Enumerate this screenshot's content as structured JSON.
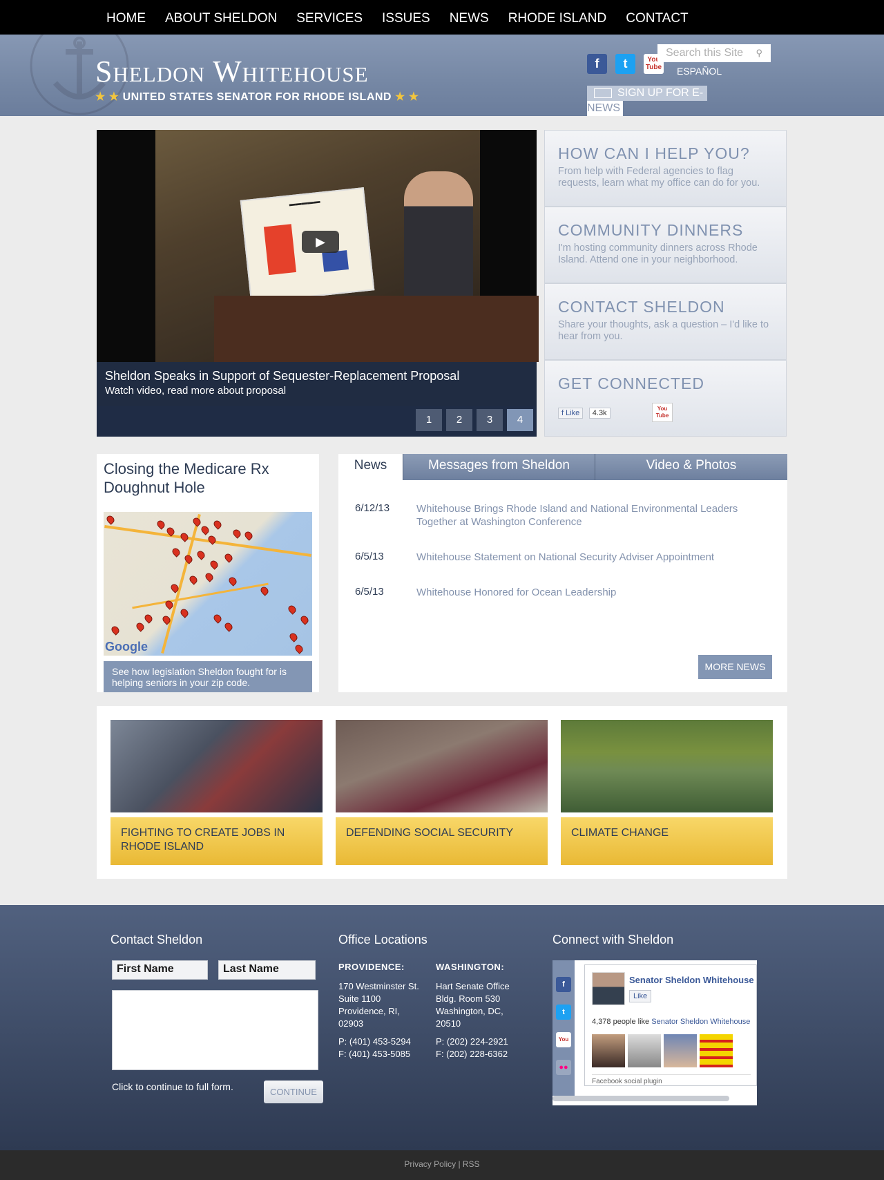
{
  "nav": [
    "HOME",
    "ABOUT SHELDON",
    "SERVICES",
    "ISSUES",
    "NEWS",
    "RHODE ISLAND",
    "CONTACT"
  ],
  "header": {
    "title": "Sheldon Whitehouse",
    "subtitle": "UNITED STATES SENATOR FOR RHODE ISLAND",
    "search_placeholder": "Search this Site",
    "espanol": "ESPAÑOL",
    "signup_line1": "SIGN UP FOR E-",
    "signup_line2": "NEWS",
    "icons": [
      "facebook-icon",
      "twitter-icon",
      "youtube-icon",
      "search-icon",
      "envelope-icon"
    ]
  },
  "hero": {
    "title": "Sheldon Speaks in Support of Sequester-Replacement Proposal",
    "subtitle": "Watch video, read more about proposal",
    "pages": [
      "1",
      "2",
      "3",
      "4"
    ],
    "active_page": "4"
  },
  "sidebar": [
    {
      "title": "HOW CAN I HELP YOU?",
      "text": "From help with Federal agencies to flag requests, learn what my office can do for you."
    },
    {
      "title": "COMMUNITY DINNERS",
      "text": "I'm hosting community dinners across Rhode Island. Attend one in your neighborhood."
    },
    {
      "title": "CONTACT SHELDON",
      "text": "Share your thoughts, ask a question – I'd like to hear from you."
    },
    {
      "title": "GET CONNECTED",
      "like_label": "Like",
      "like_count": "4.3k"
    }
  ],
  "medicare": {
    "title": "Closing the Medicare Rx Doughnut Hole",
    "map_brand": "Google",
    "cta": "See how legislation Sheldon fought for is helping seniors in your zip code."
  },
  "news": {
    "tabs": [
      "News",
      "Messages from Sheldon",
      "Video & Photos"
    ],
    "active_tab": "News",
    "items": [
      {
        "date": "6/12/13",
        "title": "Whitehouse Brings Rhode Island and National Environmental Leaders Together at Washington Conference"
      },
      {
        "date": "6/5/13",
        "title": "Whitehouse Statement on National Security Adviser Appointment"
      },
      {
        "date": "6/5/13",
        "title": "Whitehouse Honored for Ocean Leadership"
      }
    ],
    "more": "MORE NEWS"
  },
  "issues": [
    {
      "label": "FIGHTING TO CREATE JOBS IN RHODE ISLAND"
    },
    {
      "label": "DEFENDING SOCIAL SECURITY"
    },
    {
      "label": "CLIMATE CHANGE"
    }
  ],
  "footer": {
    "contact_heading": "Contact Sheldon",
    "first_name": "First Name",
    "last_name": "Last Name",
    "note": "Click to continue to full form.",
    "continue": "CONTINUE",
    "offices_heading": "Office Locations",
    "providence": {
      "label": "PROVIDENCE:",
      "lines": [
        "170 Westminster St.",
        "Suite 1100",
        "Providence, RI,",
        "02903"
      ],
      "phone": "P: (401) 453-5294",
      "fax": "F: (401) 453-5085"
    },
    "washington": {
      "label": "WASHINGTON:",
      "lines": [
        "Hart Senate Office",
        "Bldg. Room 530",
        "Washington, DC,",
        "20510"
      ],
      "phone": "P: (202) 224-2921",
      "fax": "F: (202) 228-6362"
    },
    "connect_heading": "Connect with Sheldon",
    "fb_page_name": "Senator Sheldon Whitehouse",
    "fb_like": "Like",
    "fb_count_prefix": "4,378 people like ",
    "fb_count_name": "Senator Sheldon Whitehouse",
    "fb_plugin": "Facebook social plugin",
    "bottom_links": "Privacy Policy | RSS"
  }
}
